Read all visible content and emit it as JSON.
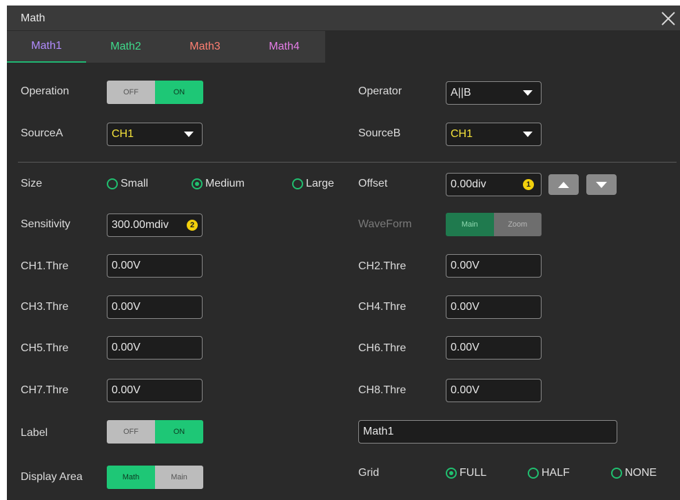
{
  "dialog": {
    "title": "Math",
    "close_icon": "close-icon"
  },
  "tabs": [
    {
      "label": "Math1",
      "color": "#b28cff",
      "active": true
    },
    {
      "label": "Math2",
      "color": "#3fdc8c"
    },
    {
      "label": "Math3",
      "color": "#ff7f72"
    },
    {
      "label": "Math4",
      "color": "#e67ee8"
    }
  ],
  "colors": {
    "accent": "#20b873",
    "ch1": "#f5e33b"
  },
  "operation": {
    "label": "Operation",
    "off": "OFF",
    "on": "ON",
    "value": "ON"
  },
  "operator": {
    "label": "Operator",
    "value": "A||B"
  },
  "sourceA": {
    "label": "SourceA",
    "value": "CH1"
  },
  "sourceB": {
    "label": "SourceB",
    "value": "CH1"
  },
  "size": {
    "label": "Size",
    "options": [
      "Small",
      "Medium",
      "Large"
    ],
    "selected": "Medium"
  },
  "offset": {
    "label": "Offset",
    "value": "0.00div",
    "badge": "1"
  },
  "sensitivity": {
    "label": "Sensitivity",
    "value": "300.00mdiv",
    "badge": "2"
  },
  "waveform": {
    "label": "WaveForm",
    "main": "Main",
    "zoom": "Zoom"
  },
  "thresholds": [
    {
      "label": "CH1.Thre",
      "value": "0.00V"
    },
    {
      "label": "CH2.Thre",
      "value": "0.00V"
    },
    {
      "label": "CH3.Thre",
      "value": "0.00V"
    },
    {
      "label": "CH4.Thre",
      "value": "0.00V"
    },
    {
      "label": "CH5.Thre",
      "value": "0.00V"
    },
    {
      "label": "CH6.Thre",
      "value": "0.00V"
    },
    {
      "label": "CH7.Thre",
      "value": "0.00V"
    },
    {
      "label": "CH8.Thre",
      "value": "0.00V"
    }
  ],
  "label_toggle": {
    "label": "Label",
    "off": "OFF",
    "on": "ON",
    "text": "Math1"
  },
  "display_area": {
    "label": "Display Area",
    "math": "Math",
    "main": "Main"
  },
  "grid": {
    "label": "Grid",
    "options": [
      "FULL",
      "HALF",
      "NONE"
    ],
    "selected": "FULL"
  }
}
